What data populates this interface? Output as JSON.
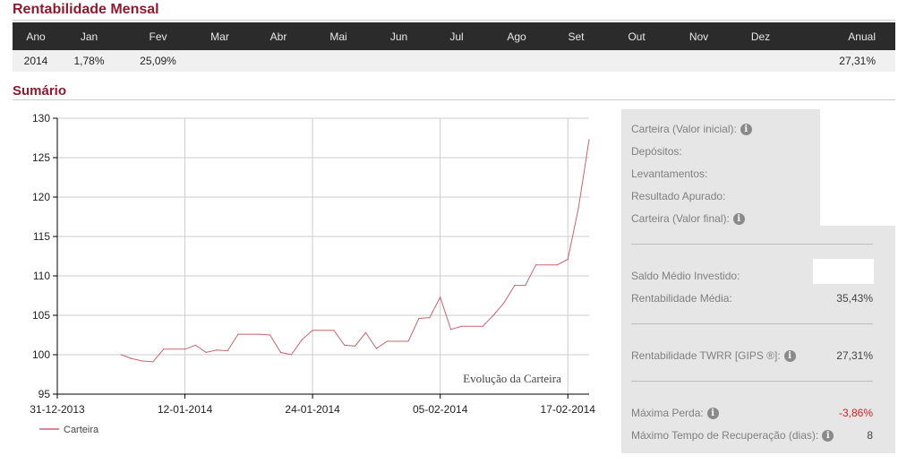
{
  "monthly": {
    "title": "Rentabilidade Mensal",
    "headers": [
      "Ano",
      "Jan",
      "Fev",
      "Mar",
      "Abr",
      "Mai",
      "Jun",
      "Jul",
      "Ago",
      "Set",
      "Out",
      "Nov",
      "Dez",
      "Anual"
    ],
    "row": [
      "2014",
      "1,78%",
      "25,09%",
      "",
      "",
      "",
      "",
      "",
      "",
      "",
      "",
      "",
      "",
      "27,31%"
    ]
  },
  "summary": {
    "title": "Sumário",
    "items": [
      {
        "label": "Carteira (Valor inicial):",
        "value": "",
        "info": true
      },
      {
        "label": "Depósitos:",
        "value": "",
        "info": false
      },
      {
        "label": "Levantamentos:",
        "value": "",
        "info": false
      },
      {
        "label": "Resultado Apurado:",
        "value": "",
        "info": false
      },
      {
        "label": "Carteira (Valor final):",
        "value": "",
        "info": true
      },
      {
        "label": "Saldo Médio Investido:",
        "value": "",
        "info": false
      },
      {
        "label": "Rentabilidade Média:",
        "value": "35,43%",
        "info": false
      },
      {
        "label": "Rentabilidade TWRR [GIPS ®]:",
        "value": "27,31%",
        "info": true
      },
      {
        "label": "Máxima Perda:",
        "value": "-3,86%",
        "info": true
      },
      {
        "label": "Máximo Tempo de Recuperação (dias):",
        "value": "8",
        "info": true
      }
    ],
    "info_glyph": "i"
  },
  "chart_data": {
    "type": "line",
    "annotation": "Evolução da Carteira",
    "legend": "bottom-left",
    "grid": true,
    "xlim": [
      "2013-12-31",
      "2014-02-19"
    ],
    "ylim": [
      95,
      130
    ],
    "yticks": [
      95,
      100,
      105,
      110,
      115,
      120,
      125,
      130
    ],
    "xticks": [
      "31-12-2013",
      "12-01-2014",
      "24-01-2014",
      "05-02-2014",
      "17-02-2014"
    ],
    "series": [
      {
        "name": "Carteira",
        "color": "#c8646e",
        "points": [
          [
            "2014-01-06",
            100.0
          ],
          [
            "2014-01-07",
            99.5
          ],
          [
            "2014-01-08",
            99.2
          ],
          [
            "2014-01-09",
            99.1
          ],
          [
            "2014-01-10",
            100.7
          ],
          [
            "2014-01-12",
            100.7
          ],
          [
            "2014-01-13",
            101.2
          ],
          [
            "2014-01-14",
            100.3
          ],
          [
            "2014-01-15",
            100.6
          ],
          [
            "2014-01-16",
            100.5
          ],
          [
            "2014-01-17",
            102.6
          ],
          [
            "2014-01-19",
            102.6
          ],
          [
            "2014-01-20",
            102.5
          ],
          [
            "2014-01-21",
            100.3
          ],
          [
            "2014-01-22",
            100.0
          ],
          [
            "2014-01-23",
            101.9
          ],
          [
            "2014-01-24",
            103.1
          ],
          [
            "2014-01-26",
            103.1
          ],
          [
            "2014-01-27",
            101.2
          ],
          [
            "2014-01-28",
            101.1
          ],
          [
            "2014-01-29",
            102.8
          ],
          [
            "2014-01-30",
            100.8
          ],
          [
            "2014-01-31",
            101.7
          ],
          [
            "2014-02-02",
            101.7
          ],
          [
            "2014-02-03",
            104.6
          ],
          [
            "2014-02-04",
            104.7
          ],
          [
            "2014-02-05",
            107.3
          ],
          [
            "2014-02-06",
            103.2
          ],
          [
            "2014-02-07",
            103.6
          ],
          [
            "2014-02-09",
            103.6
          ],
          [
            "2014-02-10",
            105.0
          ],
          [
            "2014-02-11",
            106.6
          ],
          [
            "2014-02-12",
            108.8
          ],
          [
            "2014-02-13",
            108.8
          ],
          [
            "2014-02-14",
            111.4
          ],
          [
            "2014-02-16",
            111.4
          ],
          [
            "2014-02-17",
            112.1
          ],
          [
            "2014-02-18",
            118.6
          ],
          [
            "2014-02-19",
            127.3
          ]
        ]
      }
    ]
  }
}
